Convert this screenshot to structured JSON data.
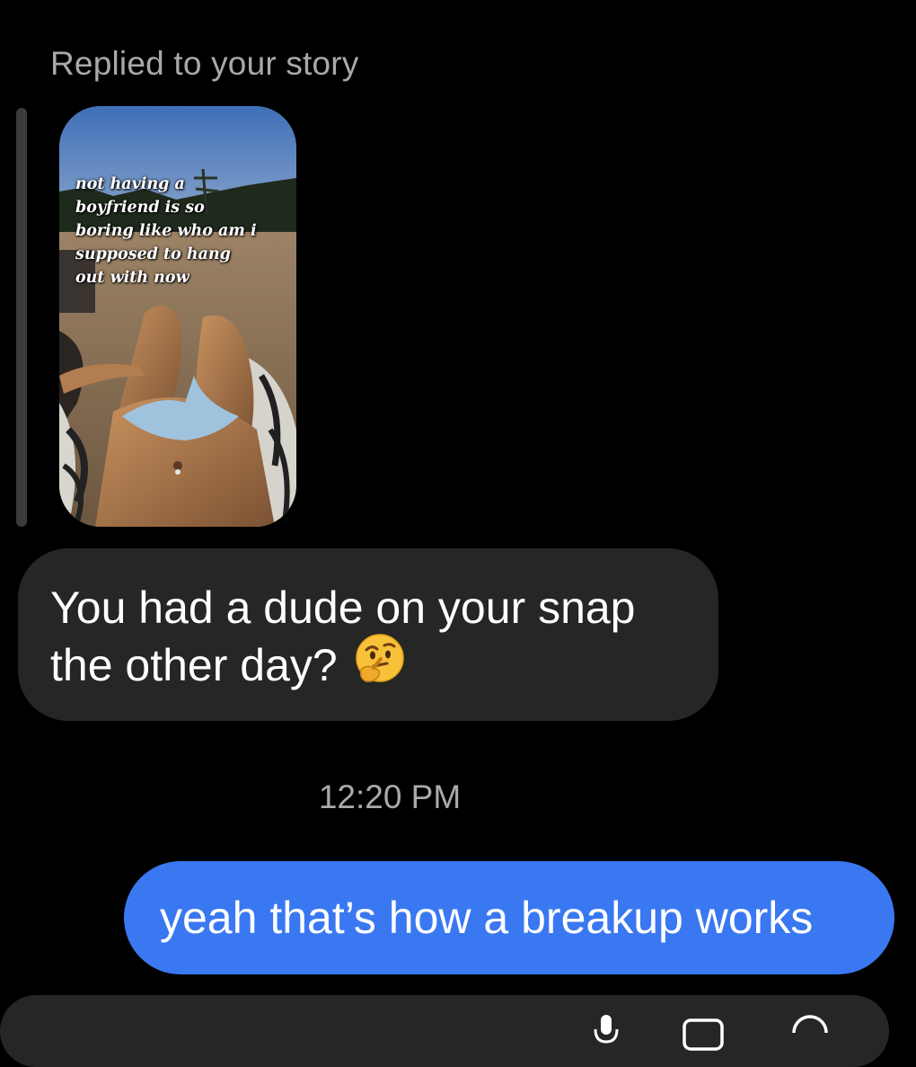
{
  "reply_header": "Replied to your story",
  "story": {
    "caption_lines": [
      "not having a",
      "boyfriend is so",
      "boring like who am i",
      "supposed to hang",
      "out with now"
    ]
  },
  "messages": {
    "received": {
      "line1": "You had a dude on your snap",
      "line2": "the other day?",
      "emoji": "thinking-face-emoji"
    },
    "timestamp": "12:20 PM",
    "sent": {
      "text": "yeah that’s how a breakup works"
    }
  },
  "composer": {
    "icons": [
      "microphone-icon",
      "photo-icon",
      "sticker-icon"
    ]
  },
  "colors": {
    "background": "#000000",
    "received_bubble": "#262626",
    "sent_bubble": "#3a78f2",
    "meta_text": "#a9a9a9"
  }
}
